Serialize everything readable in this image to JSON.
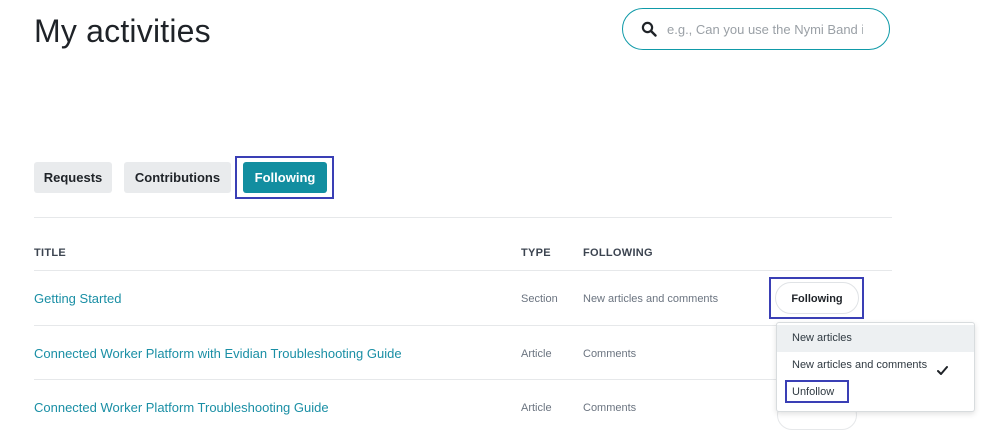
{
  "page_title": "My activities",
  "search": {
    "placeholder": "e.g., Can you use the Nymi Band in",
    "icon": "search-icon"
  },
  "tabs": [
    {
      "label": "Requests",
      "active": false
    },
    {
      "label": "Contributions",
      "active": false
    },
    {
      "label": "Following",
      "active": true
    }
  ],
  "table": {
    "headers": {
      "title": "TITLE",
      "type": "TYPE",
      "following": "FOLLOWING"
    },
    "rows": [
      {
        "title": "Getting Started",
        "type": "Section",
        "following": "New articles and comments"
      },
      {
        "title": "Connected Worker Platform with Evidian Troubleshooting Guide",
        "type": "Article",
        "following": "Comments"
      },
      {
        "title": "Connected Worker Platform Troubleshooting Guide",
        "type": "Article",
        "following": "Comments"
      }
    ]
  },
  "follow_button": {
    "label": "Following"
  },
  "dropdown": {
    "items": [
      {
        "label": "New articles",
        "checked": false
      },
      {
        "label": "New articles and comments",
        "checked": true
      },
      {
        "label": "Unfollow",
        "checked": false
      }
    ]
  },
  "colors": {
    "accent": "#128ea0",
    "link": "#1a8fa5",
    "highlight": "#3a3fb5"
  }
}
